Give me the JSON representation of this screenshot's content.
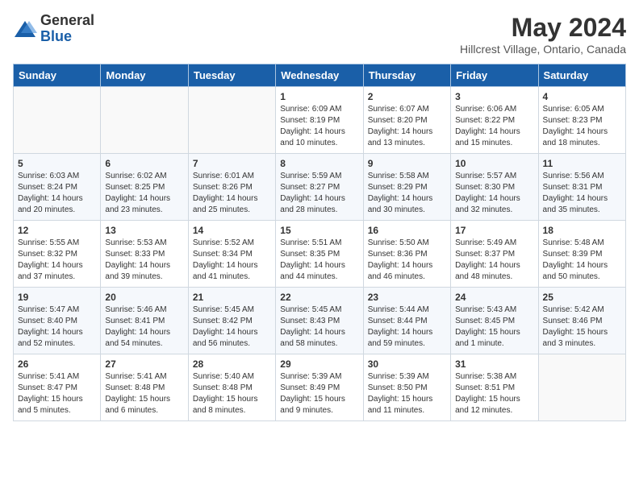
{
  "logo": {
    "general": "General",
    "blue": "Blue"
  },
  "header": {
    "month_year": "May 2024",
    "location": "Hillcrest Village, Ontario, Canada"
  },
  "weekdays": [
    "Sunday",
    "Monday",
    "Tuesday",
    "Wednesday",
    "Thursday",
    "Friday",
    "Saturday"
  ],
  "weeks": [
    [
      {
        "day": "",
        "info": ""
      },
      {
        "day": "",
        "info": ""
      },
      {
        "day": "",
        "info": ""
      },
      {
        "day": "1",
        "info": "Sunrise: 6:09 AM\nSunset: 8:19 PM\nDaylight: 14 hours\nand 10 minutes."
      },
      {
        "day": "2",
        "info": "Sunrise: 6:07 AM\nSunset: 8:20 PM\nDaylight: 14 hours\nand 13 minutes."
      },
      {
        "day": "3",
        "info": "Sunrise: 6:06 AM\nSunset: 8:22 PM\nDaylight: 14 hours\nand 15 minutes."
      },
      {
        "day": "4",
        "info": "Sunrise: 6:05 AM\nSunset: 8:23 PM\nDaylight: 14 hours\nand 18 minutes."
      }
    ],
    [
      {
        "day": "5",
        "info": "Sunrise: 6:03 AM\nSunset: 8:24 PM\nDaylight: 14 hours\nand 20 minutes."
      },
      {
        "day": "6",
        "info": "Sunrise: 6:02 AM\nSunset: 8:25 PM\nDaylight: 14 hours\nand 23 minutes."
      },
      {
        "day": "7",
        "info": "Sunrise: 6:01 AM\nSunset: 8:26 PM\nDaylight: 14 hours\nand 25 minutes."
      },
      {
        "day": "8",
        "info": "Sunrise: 5:59 AM\nSunset: 8:27 PM\nDaylight: 14 hours\nand 28 minutes."
      },
      {
        "day": "9",
        "info": "Sunrise: 5:58 AM\nSunset: 8:29 PM\nDaylight: 14 hours\nand 30 minutes."
      },
      {
        "day": "10",
        "info": "Sunrise: 5:57 AM\nSunset: 8:30 PM\nDaylight: 14 hours\nand 32 minutes."
      },
      {
        "day": "11",
        "info": "Sunrise: 5:56 AM\nSunset: 8:31 PM\nDaylight: 14 hours\nand 35 minutes."
      }
    ],
    [
      {
        "day": "12",
        "info": "Sunrise: 5:55 AM\nSunset: 8:32 PM\nDaylight: 14 hours\nand 37 minutes."
      },
      {
        "day": "13",
        "info": "Sunrise: 5:53 AM\nSunset: 8:33 PM\nDaylight: 14 hours\nand 39 minutes."
      },
      {
        "day": "14",
        "info": "Sunrise: 5:52 AM\nSunset: 8:34 PM\nDaylight: 14 hours\nand 41 minutes."
      },
      {
        "day": "15",
        "info": "Sunrise: 5:51 AM\nSunset: 8:35 PM\nDaylight: 14 hours\nand 44 minutes."
      },
      {
        "day": "16",
        "info": "Sunrise: 5:50 AM\nSunset: 8:36 PM\nDaylight: 14 hours\nand 46 minutes."
      },
      {
        "day": "17",
        "info": "Sunrise: 5:49 AM\nSunset: 8:37 PM\nDaylight: 14 hours\nand 48 minutes."
      },
      {
        "day": "18",
        "info": "Sunrise: 5:48 AM\nSunset: 8:39 PM\nDaylight: 14 hours\nand 50 minutes."
      }
    ],
    [
      {
        "day": "19",
        "info": "Sunrise: 5:47 AM\nSunset: 8:40 PM\nDaylight: 14 hours\nand 52 minutes."
      },
      {
        "day": "20",
        "info": "Sunrise: 5:46 AM\nSunset: 8:41 PM\nDaylight: 14 hours\nand 54 minutes."
      },
      {
        "day": "21",
        "info": "Sunrise: 5:45 AM\nSunset: 8:42 PM\nDaylight: 14 hours\nand 56 minutes."
      },
      {
        "day": "22",
        "info": "Sunrise: 5:45 AM\nSunset: 8:43 PM\nDaylight: 14 hours\nand 58 minutes."
      },
      {
        "day": "23",
        "info": "Sunrise: 5:44 AM\nSunset: 8:44 PM\nDaylight: 14 hours\nand 59 minutes."
      },
      {
        "day": "24",
        "info": "Sunrise: 5:43 AM\nSunset: 8:45 PM\nDaylight: 15 hours\nand 1 minute."
      },
      {
        "day": "25",
        "info": "Sunrise: 5:42 AM\nSunset: 8:46 PM\nDaylight: 15 hours\nand 3 minutes."
      }
    ],
    [
      {
        "day": "26",
        "info": "Sunrise: 5:41 AM\nSunset: 8:47 PM\nDaylight: 15 hours\nand 5 minutes."
      },
      {
        "day": "27",
        "info": "Sunrise: 5:41 AM\nSunset: 8:48 PM\nDaylight: 15 hours\nand 6 minutes."
      },
      {
        "day": "28",
        "info": "Sunrise: 5:40 AM\nSunset: 8:48 PM\nDaylight: 15 hours\nand 8 minutes."
      },
      {
        "day": "29",
        "info": "Sunrise: 5:39 AM\nSunset: 8:49 PM\nDaylight: 15 hours\nand 9 minutes."
      },
      {
        "day": "30",
        "info": "Sunrise: 5:39 AM\nSunset: 8:50 PM\nDaylight: 15 hours\nand 11 minutes."
      },
      {
        "day": "31",
        "info": "Sunrise: 5:38 AM\nSunset: 8:51 PM\nDaylight: 15 hours\nand 12 minutes."
      },
      {
        "day": "",
        "info": ""
      }
    ]
  ]
}
